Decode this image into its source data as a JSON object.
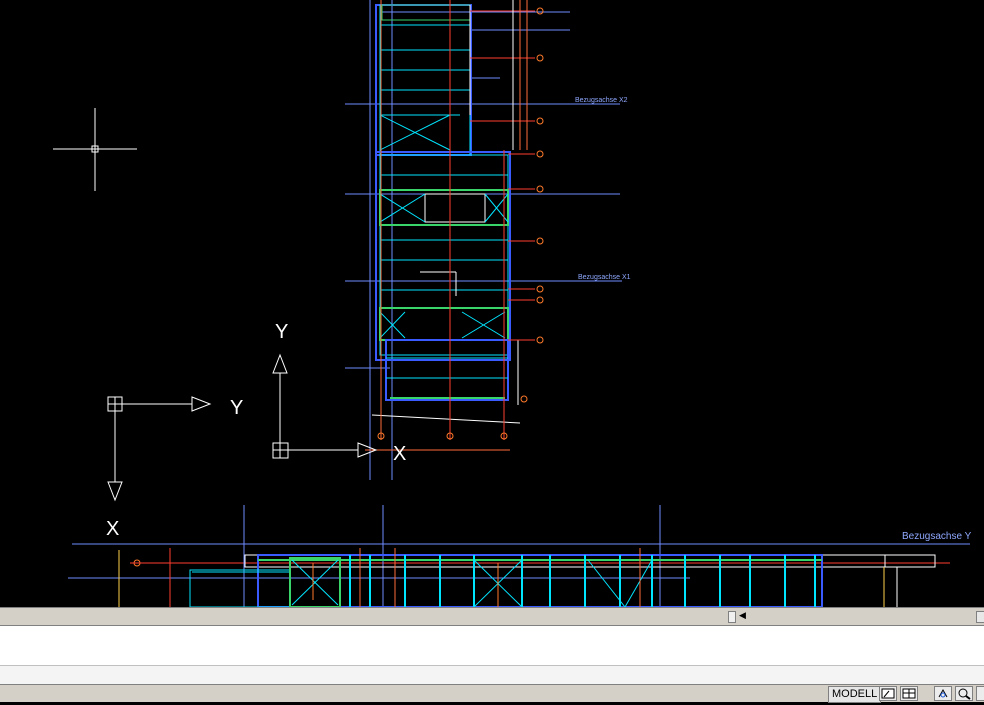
{
  "viewport": {
    "labels": {
      "axis_x2": "Bezugsachse X2",
      "axis_x1": "Bezugsachse X1",
      "axis_y": "Bezugsachse Y"
    },
    "ucs_large": {
      "x_label": "X",
      "y_label": "Y"
    },
    "ucs_small": {
      "x_label": "X",
      "y_label": "Y"
    }
  },
  "statusbar": {
    "model_label": "MODELL",
    "buttons": [
      "layout-icon",
      "layout-multi-icon",
      "pan-icon",
      "zoom-icon",
      "orbit-icon"
    ]
  },
  "colors": {
    "background": "#000000",
    "cyan": "#00e5ff",
    "blue": "#3a5bff",
    "green": "#39d46a",
    "red": "#ff3b2f",
    "orange": "#ff8a3a",
    "white": "#ffffff"
  }
}
